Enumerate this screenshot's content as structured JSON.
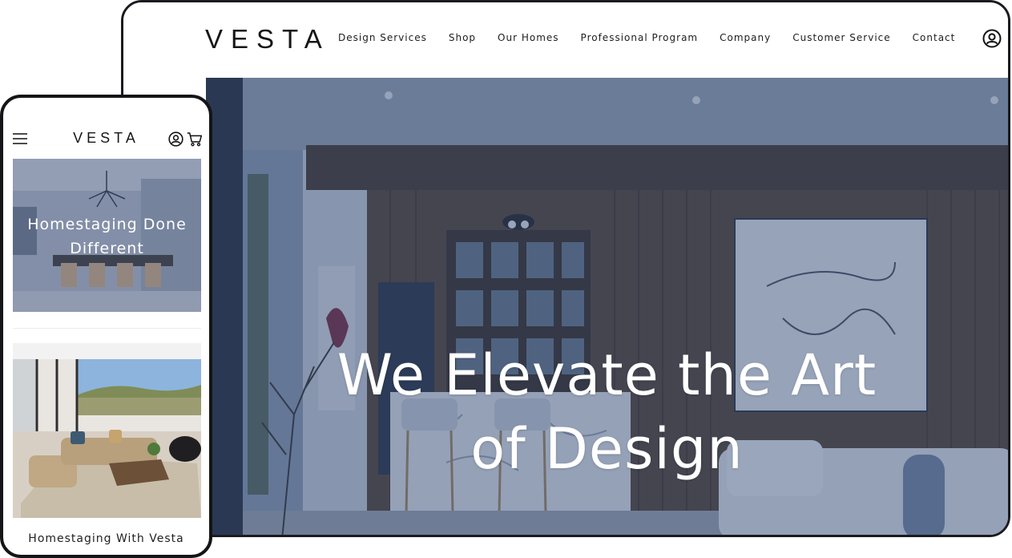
{
  "desktop": {
    "logo": "VESTA",
    "nav": [
      {
        "label": "Design Services"
      },
      {
        "label": "Shop"
      },
      {
        "label": "Our Homes"
      },
      {
        "label": "Professional Program"
      },
      {
        "label": "Company"
      },
      {
        "label": "Customer Service"
      },
      {
        "label": "Contact"
      }
    ],
    "user_icon": "user-circle-icon",
    "hero": {
      "line1": "We Elevate the Art",
      "line2": "of Design"
    }
  },
  "mobile": {
    "logo": "VESTA",
    "menu_icon": "hamburger-menu-icon",
    "user_icon": "user-circle-icon",
    "cart_icon": "shopping-cart-icon",
    "card1": {
      "title_line1": "Homestaging Done",
      "title_line2": "Different"
    },
    "card2": {
      "title": "Homestaging With Vesta"
    }
  },
  "colors": {
    "frame": "#1b1b1f",
    "hero_overlay": "#263e6c",
    "text_dark": "#1d1d1d",
    "text_light": "#ffffff"
  }
}
